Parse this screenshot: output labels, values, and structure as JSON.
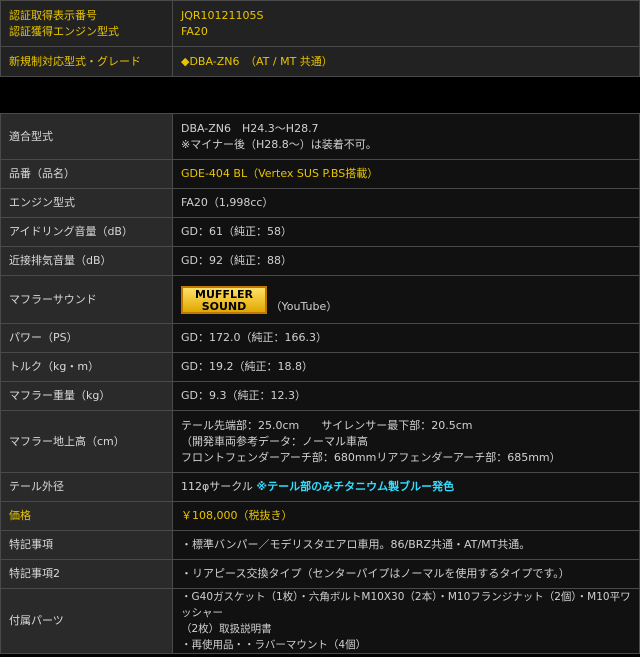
{
  "header": {
    "cert_label_1": "認証取得表示番号",
    "cert_label_2": "認証獲得エンジン型式",
    "cert_value_1": "JQR10121105S",
    "cert_value_2": "FA20",
    "new_reg_label": "新規制対応型式・グレード",
    "new_reg_value": "◆DBA-ZN6　（AT / MT 共通）"
  },
  "specs": {
    "model_label": "適合型式",
    "model_line1": "DBA-ZN6　H24.3～H28.7",
    "model_line2": "※マイナー後（H28.8～）は装着不可。",
    "part_label": "品番（品名）",
    "part_value": "GDE-404 BL（Vertex SUS P.BS搭載）",
    "engine_label": "エンジン型式",
    "engine_value": "FA20（1,998cc）",
    "idle_label": "アイドリング音量（dB）",
    "idle_value": "GD：61（純正：58）",
    "prox_label": "近接排気音量（dB）",
    "prox_value": "GD：92（純正：88）",
    "sound_label": "マフラーサウンド",
    "sound_button_line1": "MUFFLER",
    "sound_button_line2": "SOUND",
    "sound_suffix": "（YouTube）",
    "power_label": "パワー（PS）",
    "power_value": "GD：172.0（純正：166.3）",
    "torque_label": "トルク（kg・m）",
    "torque_value": "GD：19.2（純正：18.8）",
    "weight_label": "マフラー重量（kg）",
    "weight_value": "GD：9.3（純正：12.3）",
    "height_label": "マフラー地上高（cm）",
    "height_line1": "テール先端部：25.0cm　　サイレンサー最下部：20.5cm",
    "height_line2": "（開発車両参考データ：ノーマル車高",
    "height_line3": "フロントフェンダーアーチ部：680mmリアフェンダーアーチ部：685mm）",
    "tail_label": "テール外径",
    "tail_value": "112φサークル",
    "tail_note": "※テール部のみチタニウム製ブルー発色",
    "price_label": "価格",
    "price_value": "￥108,000（税抜き）",
    "feature_label": "特記事項",
    "feature_value": "・標準バンパー／モデリスタエアロ車用。86/BRZ共通・AT/MT共通。",
    "feature2_label": "特記事項2",
    "feature2_value": "・リアピース交換タイプ（センターパイプはノーマルを使用するタイプです。）",
    "parts_label": "付属パーツ",
    "parts_line1": "・G40ガスケット（1枚）・六角ボルトM10X30（2本）・M10フランジナット（2個）・M10平ワッシャー",
    "parts_line2": "（2枚）取扱説明書",
    "parts_line3": "・再使用品・・ラバーマウント（4個）"
  }
}
